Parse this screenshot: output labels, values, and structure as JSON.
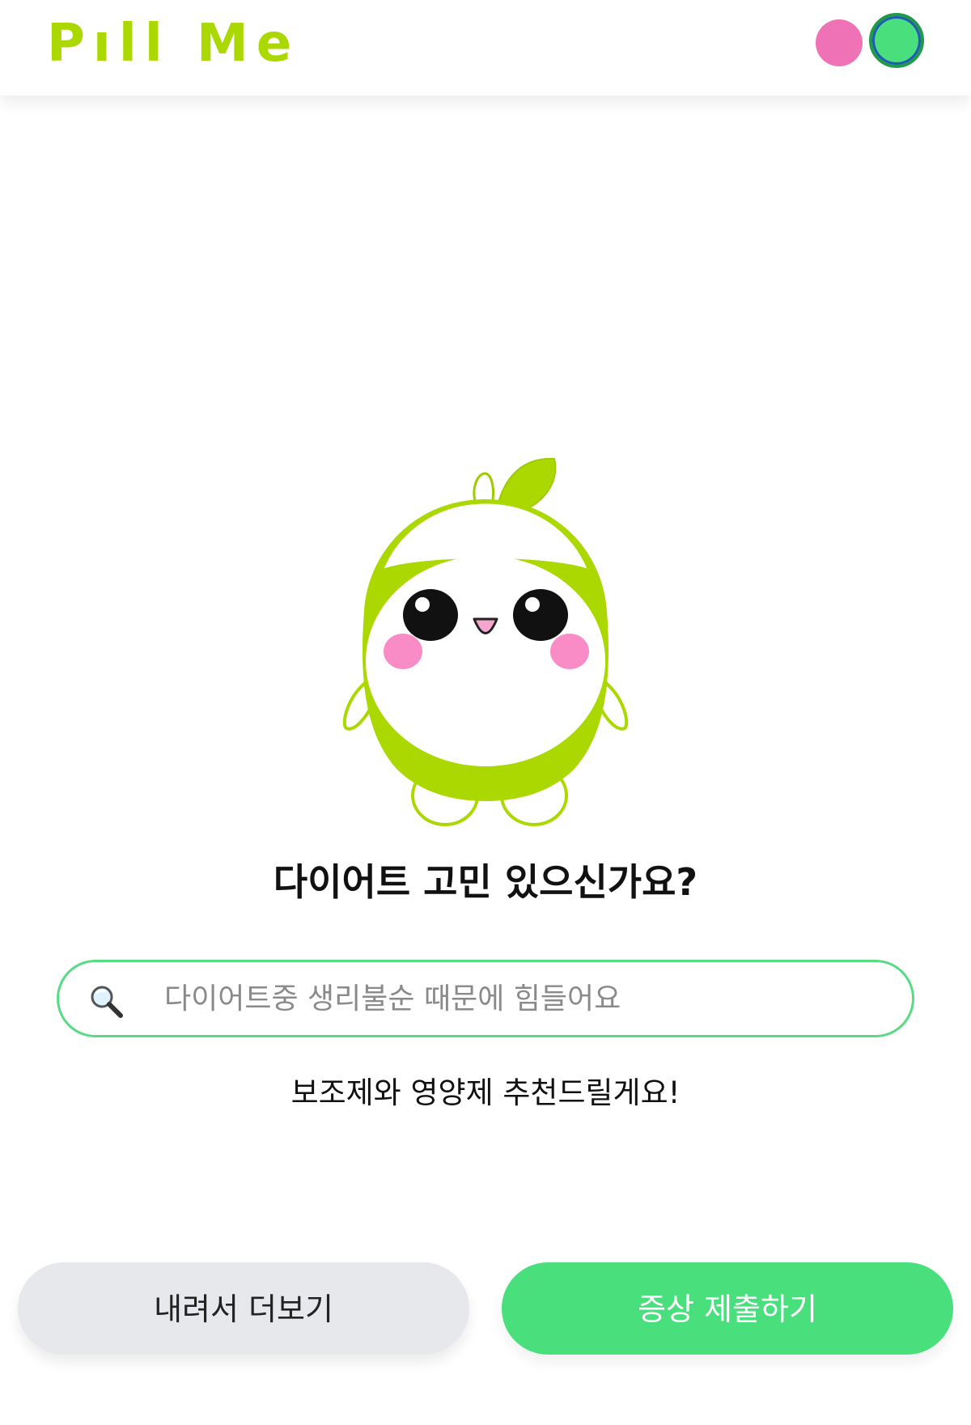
{
  "header": {
    "logo": "Pıll Me",
    "profile_dots": [
      {
        "name": "pink-dot",
        "color": "#f072b6"
      },
      {
        "name": "green-dot",
        "color": "#49df7d"
      }
    ]
  },
  "colors": {
    "brand_lime": "#aad800",
    "accent_green": "#49df7d",
    "button_gray": "#e7e8ec"
  },
  "main": {
    "mascot_icon": "green-pill-mascot-icon",
    "title": "다이어트 고민 있으신가요?",
    "search": {
      "icon": "search-icon",
      "placeholder": "다이어트중 생리불순 때문에 힘들어요",
      "value": ""
    },
    "subtitle": "보조제와 영양제 추천드릴게요!"
  },
  "footer": {
    "more_label": "내려서 더보기",
    "submit_label": "증상 제출하기"
  }
}
